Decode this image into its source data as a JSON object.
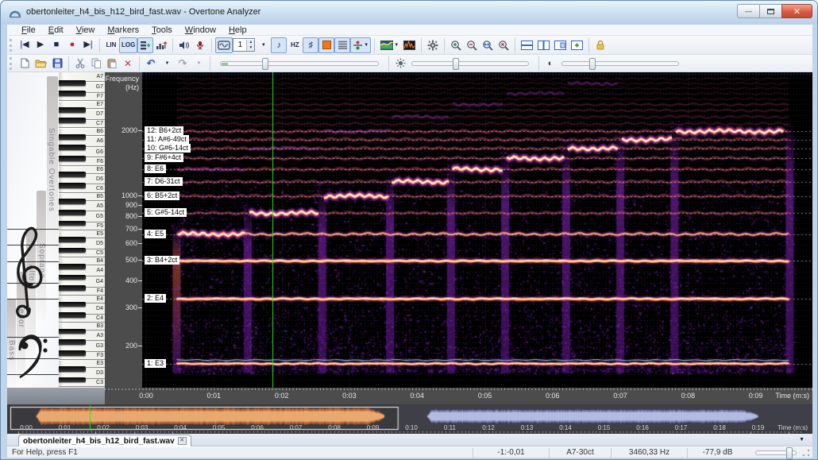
{
  "window": {
    "title": "obertonleiter_h4_bis_h12_bird_fast.wav - Overtone Analyzer"
  },
  "menu": {
    "items": [
      "File",
      "Edit",
      "View",
      "Markers",
      "Tools",
      "Window",
      "Help"
    ]
  },
  "toolbar": {
    "lin_label": "LIN",
    "log_label": "LOG",
    "hz_label": "HZ",
    "note_glyph": "♪",
    "sharp_glyph": "♯",
    "octave_value": "1"
  },
  "left_panel": {
    "overtones_label": "Singable Overtones",
    "voices": [
      "Soprano",
      "Alto",
      "Tenor",
      "Bass"
    ],
    "white_keys": [
      "A7",
      "G7",
      "F7",
      "E7",
      "D7",
      "C7",
      "B6",
      "A6",
      "G6",
      "F6",
      "E6",
      "D6",
      "C6",
      "B5",
      "A5",
      "G5",
      "F5",
      "E5",
      "D5",
      "C5",
      "B4",
      "A4",
      "G4",
      "F4",
      "E4",
      "D4",
      "C4",
      "B3",
      "A3",
      "G3",
      "F3",
      "E3",
      "D3",
      "C3"
    ]
  },
  "freq_axis": {
    "title": "Frequency",
    "unit": "(Hz)",
    "ticks": [
      "2000",
      "1000",
      "900",
      "800",
      "700",
      "600",
      "500",
      "400",
      "300",
      "200"
    ]
  },
  "time_axis": {
    "ticks": [
      "0:00",
      "0:01",
      "0:02",
      "0:03",
      "0:04",
      "0:05",
      "0:06",
      "0:07",
      "0:08",
      "0:09"
    ],
    "label": "Time (m:s)"
  },
  "overview": {
    "ticks": [
      "0:00",
      "0:01",
      "0:02",
      "0:03",
      "0:04",
      "0:05",
      "0:06",
      "0:07",
      "0:08",
      "0:09",
      "0:10",
      "0:11",
      "0:12",
      "0:13",
      "0:14",
      "0:15",
      "0:16",
      "0:17",
      "0:18",
      "0:19"
    ],
    "label": "Time (m:s)"
  },
  "tab": {
    "label": "obertonleiter_h4_bis_h12_bird_fast.wav"
  },
  "status": {
    "help": "For Help, press F1",
    "cells": [
      "-1:-0,01",
      "A7-30ct",
      "3460,33 Hz",
      "-77,9 dB"
    ]
  },
  "chart_data": {
    "type": "heatmap",
    "description": "Log-frequency spectrogram of a sung overtone scale (reinforced harmonics 4 to 12 above an E3 drone), palette black-purple-orange-white",
    "fundamental_hz": 164.81,
    "fundamental_note": "E3",
    "time_range_s": [
      0,
      9.87
    ],
    "signal_span_s": [
      0.45,
      9.5
    ],
    "playhead_time_s": 1.86,
    "freq_ticks_hz": [
      2000,
      1000,
      900,
      800,
      700,
      600,
      500,
      400,
      300,
      200
    ],
    "drone_harmonics": [
      1,
      2,
      3
    ],
    "harmonic_markers": [
      {
        "n": 12,
        "label": "12: B6+2ct",
        "hz": 1977.8
      },
      {
        "n": 11,
        "label": "11: A#6-49ct",
        "hz": 1812.9
      },
      {
        "n": 10,
        "label": "10: G#6-14ct",
        "hz": 1648.1
      },
      {
        "n": 9,
        "label": "9: F#6+4ct",
        "hz": 1483.3
      },
      {
        "n": 8,
        "label": "8: E6",
        "hz": 1318.5
      },
      {
        "n": 7,
        "label": "7: D6-31ct",
        "hz": 1153.7
      },
      {
        "n": 6,
        "label": "6: B5+2ct",
        "hz": 988.9
      },
      {
        "n": 5,
        "label": "5: G#5-14ct",
        "hz": 824.1
      },
      {
        "n": 4,
        "label": "4: E5",
        "hz": 659.3
      },
      {
        "n": 3,
        "label": "3: B4+2ct",
        "hz": 494.4
      },
      {
        "n": 2,
        "label": "2: E4",
        "hz": 329.6
      },
      {
        "n": 1,
        "label": "1: E3",
        "hz": 164.8
      }
    ],
    "emphasized_steps": [
      {
        "harmonic": 4,
        "t0": 0.45,
        "t1": 1.5
      },
      {
        "harmonic": 5,
        "t0": 1.5,
        "t1": 2.6
      },
      {
        "harmonic": 6,
        "t0": 2.6,
        "t1": 3.6
      },
      {
        "harmonic": 7,
        "t0": 3.6,
        "t1": 4.5
      },
      {
        "harmonic": 8,
        "t0": 4.5,
        "t1": 5.3
      },
      {
        "harmonic": 9,
        "t0": 5.3,
        "t1": 6.2
      },
      {
        "harmonic": 10,
        "t0": 6.2,
        "t1": 7.0
      },
      {
        "harmonic": 11,
        "t0": 7.0,
        "t1": 7.8
      },
      {
        "harmonic": 12,
        "t0": 7.8,
        "t1": 9.45
      }
    ],
    "overview_waveforms": [
      {
        "color": "orange",
        "t0": 0.45,
        "t1": 9.5
      },
      {
        "color": "lavender",
        "t0": 10.6,
        "t1": 19.2
      }
    ],
    "overview_selection_s": [
      0,
      9.87
    ]
  }
}
